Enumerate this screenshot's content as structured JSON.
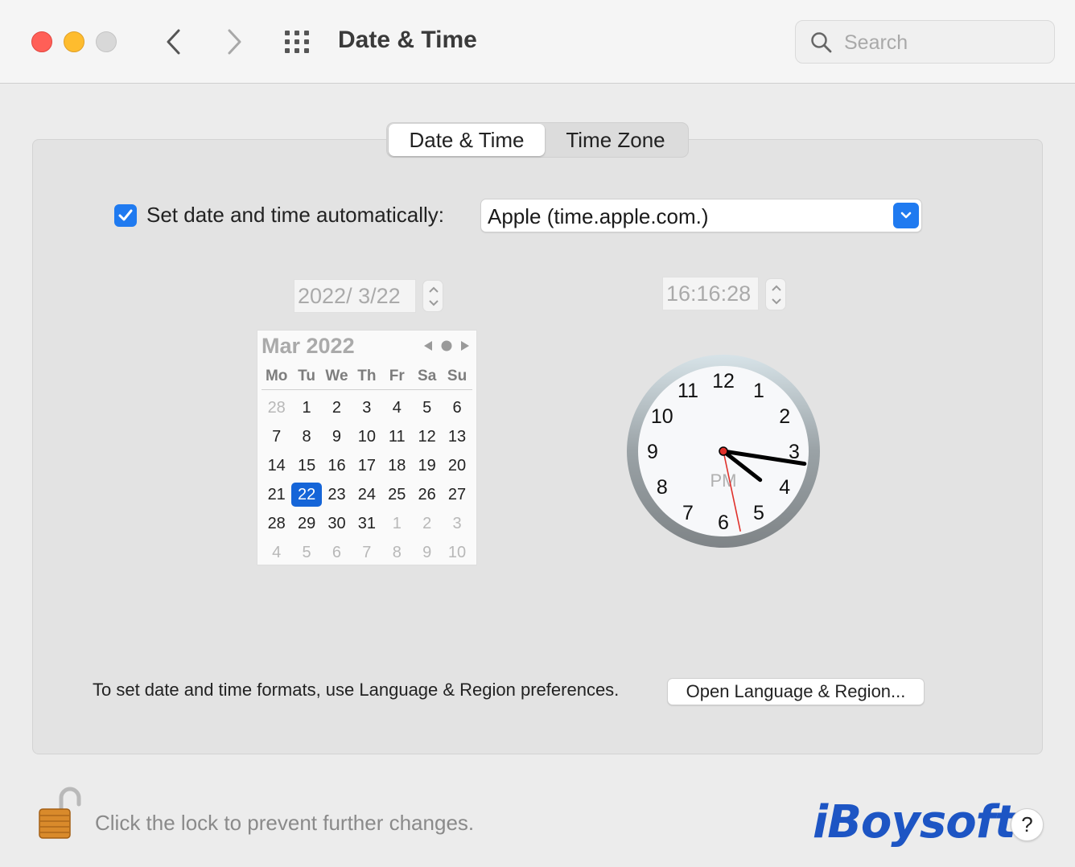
{
  "window": {
    "title": "Date & Time",
    "search_placeholder": "Search"
  },
  "tabs": [
    {
      "label": "Date & Time",
      "active": true
    },
    {
      "label": "Time Zone",
      "active": false
    }
  ],
  "auto": {
    "checked": true,
    "label": "Set date and time automatically:",
    "server": "Apple (time.apple.com.)"
  },
  "date_field": "2022/  3/22",
  "time_field": "16:16:28",
  "calendar": {
    "title": "Mar 2022",
    "weekdays": [
      "Mo",
      "Tu",
      "We",
      "Th",
      "Fr",
      "Sa",
      "Su"
    ],
    "weeks": [
      [
        {
          "d": "28",
          "m": true
        },
        {
          "d": "1"
        },
        {
          "d": "2"
        },
        {
          "d": "3"
        },
        {
          "d": "4"
        },
        {
          "d": "5"
        },
        {
          "d": "6"
        }
      ],
      [
        {
          "d": "7"
        },
        {
          "d": "8"
        },
        {
          "d": "9"
        },
        {
          "d": "10"
        },
        {
          "d": "11"
        },
        {
          "d": "12"
        },
        {
          "d": "13"
        }
      ],
      [
        {
          "d": "14"
        },
        {
          "d": "15"
        },
        {
          "d": "16"
        },
        {
          "d": "17"
        },
        {
          "d": "18"
        },
        {
          "d": "19"
        },
        {
          "d": "20"
        }
      ],
      [
        {
          "d": "21"
        },
        {
          "d": "22",
          "s": true
        },
        {
          "d": "23"
        },
        {
          "d": "24"
        },
        {
          "d": "25"
        },
        {
          "d": "26"
        },
        {
          "d": "27"
        }
      ],
      [
        {
          "d": "28"
        },
        {
          "d": "29"
        },
        {
          "d": "30"
        },
        {
          "d": "31"
        },
        {
          "d": "1",
          "m": true
        },
        {
          "d": "2",
          "m": true
        },
        {
          "d": "3",
          "m": true
        }
      ],
      [
        {
          "d": "4",
          "m": true
        },
        {
          "d": "5",
          "m": true
        },
        {
          "d": "6",
          "m": true
        },
        {
          "d": "7",
          "m": true
        },
        {
          "d": "8",
          "m": true
        },
        {
          "d": "9",
          "m": true
        },
        {
          "d": "10",
          "m": true
        }
      ]
    ]
  },
  "clock": {
    "numbers": [
      "12",
      "1",
      "2",
      "3",
      "4",
      "5",
      "6",
      "7",
      "8",
      "9",
      "10",
      "11"
    ],
    "ampm": "PM",
    "hour": 16,
    "minute": 16,
    "second": 28
  },
  "formats": {
    "text": "To set date and time formats, use Language & Region preferences.",
    "button": "Open Language & Region..."
  },
  "lock_text": "Click the lock to prevent further changes.",
  "watermark": "iBoysoft",
  "help_label": "?",
  "colors": {
    "accent": "#1f7af0",
    "selected_day": "#1565d8",
    "second_hand": "#e0302a"
  }
}
